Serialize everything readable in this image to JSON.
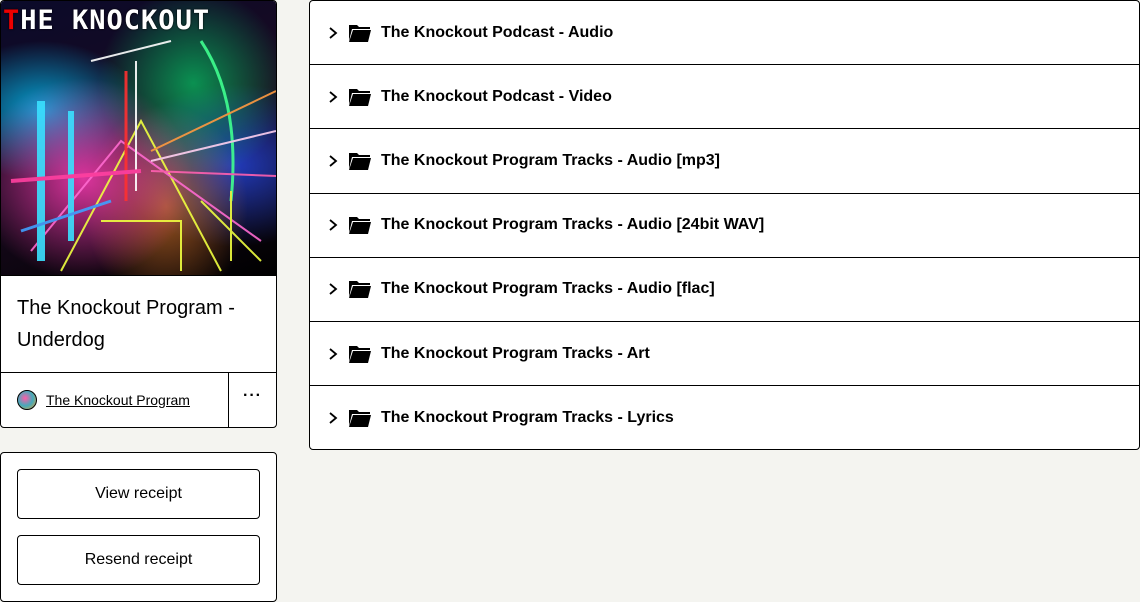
{
  "product": {
    "cover_text_accent": "T",
    "cover_text_rest": "HE KNOCKOUT",
    "name": "The Knockout Program - Underdog",
    "creator": "The Knockout Program",
    "more_label": "···"
  },
  "receipt": {
    "view_label": "View receipt",
    "resend_label": "Resend receipt"
  },
  "folders": [
    {
      "label": "The Knockout Podcast - Audio"
    },
    {
      "label": "The Knockout Podcast - Video"
    },
    {
      "label": "The Knockout Program Tracks - Audio [mp3]"
    },
    {
      "label": "The Knockout Program Tracks - Audio [24bit WAV]"
    },
    {
      "label": "The Knockout Program Tracks - Audio [flac]"
    },
    {
      "label": "The Knockout Program Tracks - Art"
    },
    {
      "label": "The Knockout Program Tracks - Lyrics"
    }
  ],
  "icons": {
    "chevron": "chevron-right-icon",
    "folder": "folder-icon"
  },
  "colors": {
    "background": "#f4f4f0",
    "border": "#000000",
    "card": "#ffffff"
  }
}
